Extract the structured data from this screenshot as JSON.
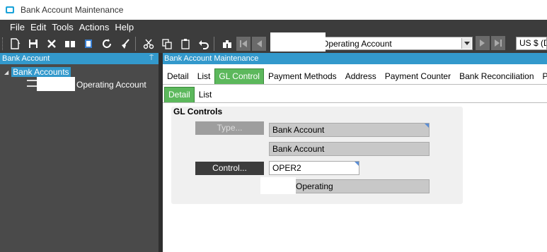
{
  "window": {
    "title": "Bank Account Maintenance"
  },
  "menu": [
    "File",
    "Edit",
    "Tools",
    "Actions",
    "Help"
  ],
  "toolbar": {
    "account_combo_value": "Operating Account",
    "currency_value": "US $ (D"
  },
  "left_panel": {
    "header": "Bank Account",
    "pin_glyph": "⍑",
    "tree_root": "Bank Accounts",
    "tree_child": "Operating Account"
  },
  "main": {
    "header": "Bank Account Maintenance",
    "tabs": [
      "Detail",
      "List",
      "GL Control",
      "Payment Methods",
      "Address",
      "Payment Counter",
      "Bank Reconciliation",
      "Pay"
    ],
    "active_tab": "GL Control",
    "subtabs": [
      "Detail",
      "List"
    ],
    "active_subtab": "Detail",
    "gl_controls": {
      "title": "GL Controls",
      "type_button": "Type...",
      "type_value": "Bank Account",
      "type_description": "Bank Account",
      "control_button": "Control...",
      "control_value": "OPER2",
      "control_description": "Operating"
    }
  },
  "colors": {
    "accent_blue": "#3399cc",
    "active_tab_green": "#5cb85c",
    "dark_bg": "#3c3c3c"
  }
}
